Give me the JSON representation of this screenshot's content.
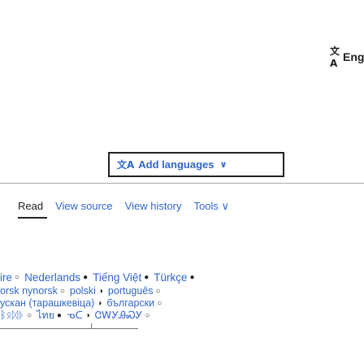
{
  "top_lang": {
    "icon": "translate-icon",
    "icon_glyph": "文A",
    "label": "Eng"
  },
  "add_languages": {
    "icon": "translate-icon",
    "icon_glyph": "文A",
    "label": "Add languages",
    "chevron": "∨"
  },
  "tabs": [
    {
      "label": "Read",
      "selected": true
    },
    {
      "label": "View source",
      "selected": false
    },
    {
      "label": "View history",
      "selected": false
    },
    {
      "label": "Tools",
      "selected": false,
      "chevron": "∨"
    }
  ],
  "lang_rows": [
    [
      {
        "text": "ire",
        "sep": "○"
      },
      {
        "text": "Nederlands",
        "sep": "●"
      },
      {
        "text": "Tiếng Việt",
        "sep": "●"
      },
      {
        "text": "Türkçe",
        "sep": "●"
      }
    ],
    [
      {
        "text": "orsk nynorsk",
        "sep": "○"
      },
      {
        "text": "polski",
        "sep": "◑"
      },
      {
        "text": "português",
        "sep": "○"
      }
    ],
    [
      {
        "text": "ускан (тарашкевіца)",
        "sep": "◑"
      },
      {
        "text": "български",
        "sep": "○"
      }
    ],
    [
      {
        "text": "ᛒᛟᛞᚦ",
        "sep": "○"
      },
      {
        "text": "ไทย",
        "sep": "●"
      },
      {
        "text": "ᓀᑕ",
        "sep": "◑"
      },
      {
        "text": "ᏣᎳᎩᎯᏍᎩ",
        "sep": "○"
      }
    ]
  ]
}
